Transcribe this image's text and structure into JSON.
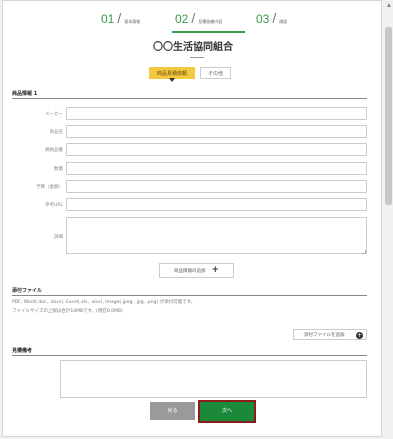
{
  "steps": [
    {
      "num": "01",
      "label": "基本情報"
    },
    {
      "num": "02",
      "label": "見積依頼内容"
    },
    {
      "num": "03",
      "label": "確認"
    }
  ],
  "org_name": "〇〇生活協同組合",
  "tabs": [
    {
      "label": "商品見積依頼",
      "active": true
    },
    {
      "label": "その他",
      "active": false
    }
  ],
  "product_section": {
    "title": "商品情報 1",
    "fields": [
      {
        "label": "メーカー",
        "value": ""
      },
      {
        "label": "商品名",
        "value": ""
      },
      {
        "label": "規格品番",
        "value": ""
      },
      {
        "label": "数量",
        "value": ""
      },
      {
        "label": "予算（金額）",
        "value": ""
      },
      {
        "label": "参考URL",
        "value": ""
      }
    ],
    "detail_label": "詳細",
    "add_button": "商品情報の追加"
  },
  "attachment_section": {
    "title": "添付ファイル",
    "note1": "PDF, Word(.doc, .docx), Excel(.xls, .xlsx), Image(.jpeg, .jpg, .png) が添付可能です。",
    "note2": "ファイルサイズの上限は合計10MBです。(現在0.0MB)",
    "add_button": "添付ファイルを追加"
  },
  "remarks_section": {
    "title": "見積備考"
  },
  "buttons": {
    "back": "戻る",
    "next": "次へ"
  },
  "colors": {
    "accent_green": "#3a9a4a",
    "tab_active": "#f5c842",
    "next_button": "#1a8a3a",
    "back_button": "#9a9a9a"
  }
}
